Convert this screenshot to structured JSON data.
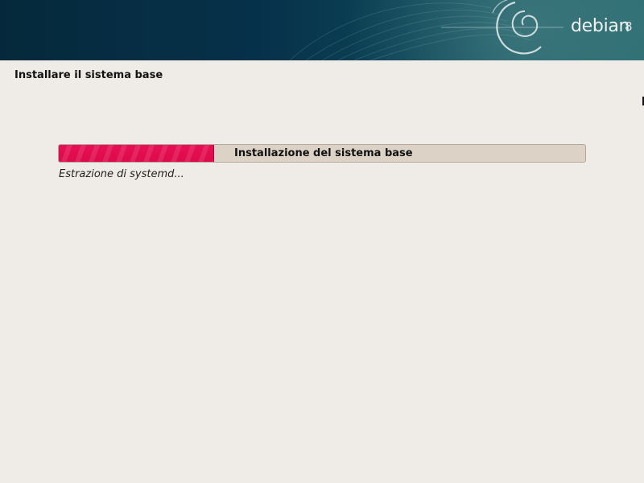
{
  "banner": {
    "logo_text": "debian",
    "version": "8",
    "icon": "debian-swirl-icon"
  },
  "page": {
    "title": "Installare il sistema base"
  },
  "progress": {
    "label": "Installazione del sistema base",
    "value": 0.295,
    "fill_color": "#e0104f",
    "status": "Estrazione di systemd..."
  },
  "colors": {
    "background": "#efebe7",
    "banner": "#06314a",
    "progress_track": "#ddd2c6"
  }
}
